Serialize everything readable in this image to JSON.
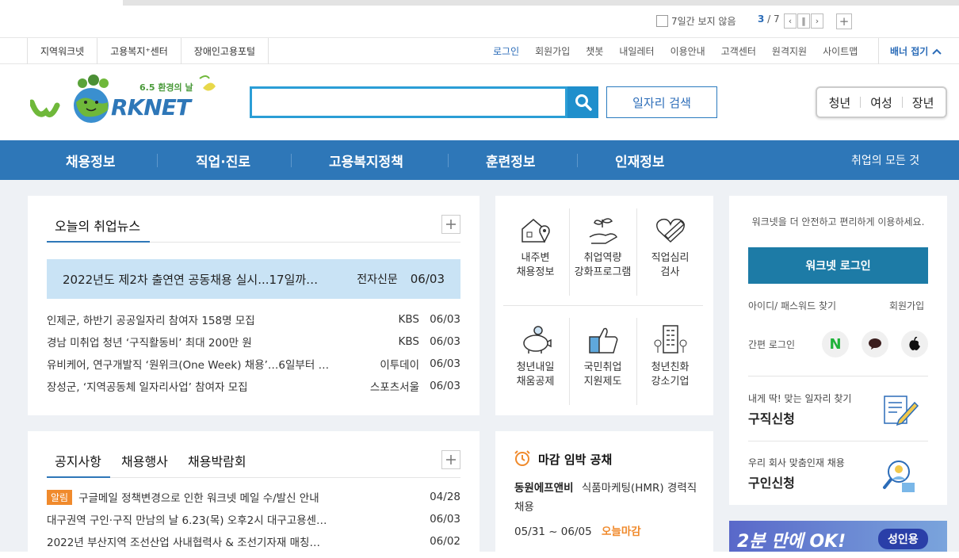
{
  "banner_ctrl": {
    "no_show_7days": "7일간 보지 않음",
    "page_current": "3",
    "page_total": "7",
    "prev": "‹",
    "pause": "‖",
    "next": "›",
    "add": "+"
  },
  "family_sites": [
    "지역워크넷",
    "고용복지⁺센터",
    "장애인고용포털"
  ],
  "util_links": [
    "로그인",
    "회원가입",
    "챗봇",
    "내일레터",
    "이용안내",
    "고객센터",
    "원격지원",
    "사이트맵"
  ],
  "banner_fold": "배너 접기",
  "logo": {
    "tagline": "6.5 환경의 날",
    "text": "RKNET"
  },
  "search": {
    "placeholder": "",
    "button": "일자리 검색"
  },
  "quick_groups": [
    "청년",
    "여성",
    "장년"
  ],
  "gnb": {
    "items": [
      "채용정보",
      "직업·진로",
      "고용복지정책",
      "훈련정보",
      "인재정보"
    ],
    "all": "취업의 모든 것"
  },
  "news": {
    "title": "오늘의 취업뉴스",
    "highlight": {
      "title": "2022년도 제2차 출연연 공동채용 실시...17일까…",
      "source": "전자신문",
      "date": "06/03"
    },
    "items": [
      {
        "title": "인제군, 하반기 공공일자리 참여자 158명 모집",
        "source": "KBS",
        "date": "06/03"
      },
      {
        "title": "경남 미취업 청년 ‘구직활동비’ 최대 200만 원",
        "source": "KBS",
        "date": "06/03"
      },
      {
        "title": "유비케어, 연구개발직 ‘원위크(One Week) 채용’…6일부터 …",
        "source": "이투데이",
        "date": "06/03"
      },
      {
        "title": "장성군, ‘지역공동체 일자리사업’ 참여자 모집",
        "source": "스포츠서울",
        "date": "06/03"
      }
    ]
  },
  "services": [
    {
      "l1": "내주변",
      "l2": "채용정보"
    },
    {
      "l1": "취업역량",
      "l2": "강화프로그램"
    },
    {
      "l1": "직업심리",
      "l2": "검사"
    },
    {
      "l1": "청년내일",
      "l2": "채움공제"
    },
    {
      "l1": "국민취업",
      "l2": "지원제도"
    },
    {
      "l1": "청년친화",
      "l2": "강소기업"
    }
  ],
  "login": {
    "message": "워크넷을 더 안전하고 편리하게 이용하세요.",
    "button": "워크넷 로그인",
    "find": "아이디/ 패스워드 찾기",
    "join": "회원가입",
    "simple": "간편 로그인",
    "naver": "N"
  },
  "cards": [
    {
      "sub": "내게 딱! 맞는 일자리 찾기",
      "title": "구직신청"
    },
    {
      "sub": "우리 회사 맞춤인재 채용",
      "title": "구인신청"
    }
  ],
  "notice": {
    "tabs": [
      "공지사항",
      "채용행사",
      "채용박람회"
    ],
    "badge": "알림",
    "items": [
      {
        "title": "구글메일 정책변경으로 인한 워크넷 메일 수/발신 안내",
        "date": "04/28"
      },
      {
        "title": "대구권역 구인·구직 만남의 날 6.23(목) 오후2시 대구고용센…",
        "date": "06/03"
      },
      {
        "title": "2022년 부산지역 조선산업 사내협력사 & 조선기자재 매칭…",
        "date": "06/02"
      }
    ]
  },
  "deadline": {
    "title": "마감 임박 공채",
    "company": "동원에프앤비",
    "job": "식품마케팅(HMR) 경력직 채용",
    "period": "05/31 ~ 06/05",
    "status": "오늘마감"
  },
  "ad": {
    "text": "2분 만에 OK!",
    "label": "성인용"
  }
}
